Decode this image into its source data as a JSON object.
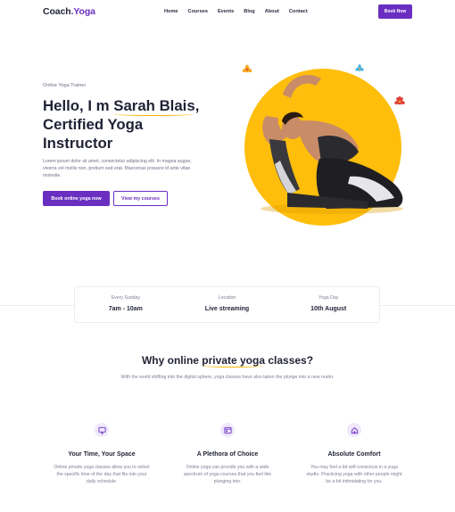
{
  "nav": {
    "logo_main": "Coach",
    "logo_accent": ".Yoga",
    "items": [
      "Home",
      "Courses",
      "Events",
      "Blog",
      "About",
      "Contact"
    ],
    "cta": "Book Now"
  },
  "hero": {
    "eyebrow": "Online Yoga Trainer",
    "headline_l1_pre": "Hello, I m ",
    "headline_l1_name": "Sarah Blais",
    "headline_l1_post": ",",
    "headline_l2": "Certified Yoga",
    "headline_l3": "Instructor",
    "body": "Lorem ipsum dolor sit amet, consectetur adipiscing elit. In magna augue, viverra vel mollis non, pretium sed erat. Maecenas posuere id ante vitae molestie.",
    "primary_cta": "Book online yoga now",
    "secondary_cta": "View my courses"
  },
  "info": [
    {
      "label": "Every Sunday",
      "value": "7am - 10am"
    },
    {
      "label": "Location",
      "value": "Live streaming"
    },
    {
      "label": "Yoga Day",
      "value": "10th August"
    }
  ],
  "why": {
    "title_pre": "Why online ",
    "title_accent": "private yoga",
    "title_post": " classes?",
    "subtitle": "With the world shifting into the digital sphere, yoga classes have also taken the plunge into a new realm.",
    "features": [
      {
        "icon": "monitor-icon",
        "title": "Your Time, Your Space",
        "desc": "Online private yoga classes allow you to select the specific time of the day that fits into your daily schedule."
      },
      {
        "icon": "browser-window-icon",
        "title": "A Plethora of Choice",
        "desc": "Online yoga can provide you with a wide spectrum of yoga courses that you feel like plunging into."
      },
      {
        "icon": "home-icon",
        "title": "Absolute Comfort",
        "desc": "You may feel a bit self-conscious in a yoga studio. Practicing yoga with other people might be a bit intimidating for you."
      }
    ]
  },
  "colors": {
    "brand": "#6a2fc1",
    "accent_yellow": "#f7b500",
    "text_dark": "#1f2235",
    "text_muted": "#7c8096"
  }
}
